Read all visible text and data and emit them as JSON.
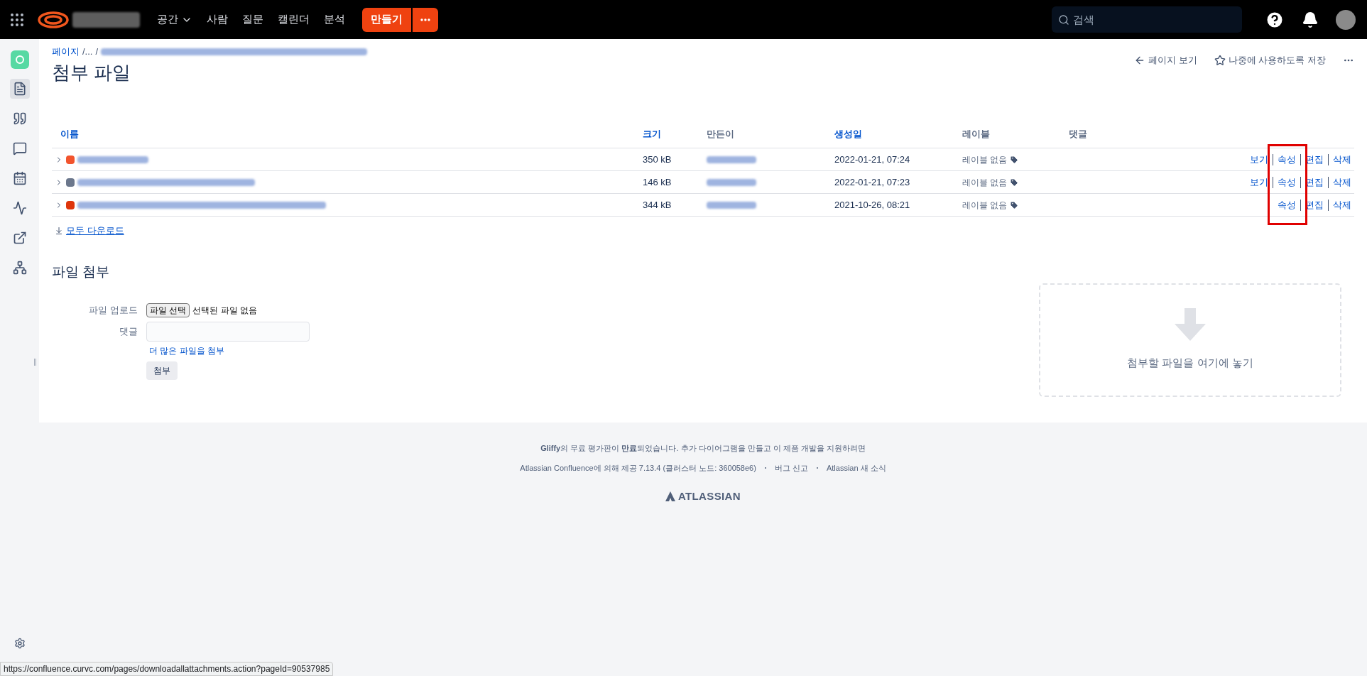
{
  "top_nav": {
    "menu": [
      {
        "label": "공간",
        "dropdown": true
      },
      {
        "label": "사람",
        "dropdown": false
      },
      {
        "label": "질문",
        "dropdown": false
      },
      {
        "label": "캘린더",
        "dropdown": false
      },
      {
        "label": "분석",
        "dropdown": false
      }
    ],
    "create_button": "만들기",
    "search": {
      "placeholder": "검색"
    }
  },
  "sidebar": {
    "items": [
      {
        "kind": "page",
        "selected": true
      },
      {
        "kind": "quote",
        "selected": false
      },
      {
        "kind": "question",
        "selected": false
      },
      {
        "kind": "calendar",
        "selected": false
      },
      {
        "kind": "activity",
        "selected": false
      },
      {
        "kind": "external",
        "selected": false
      },
      {
        "kind": "tree",
        "selected": false
      }
    ]
  },
  "breadcrumb": [
    {
      "label": "페이지",
      "kind": "link"
    },
    {
      "label": "/...",
      "kind": "text"
    },
    {
      "label": "/",
      "kind": "text"
    }
  ],
  "page_title": "첨부 파일",
  "page_actions": [
    {
      "label": "페이지 보기",
      "kind": "back"
    },
    {
      "label": "나중에 사용하도록 저장",
      "kind": "save"
    }
  ],
  "table": {
    "columns": [
      {
        "label": "이름",
        "sortable": true
      },
      {
        "label": "크기",
        "sortable": true
      },
      {
        "label": "만든이",
        "sortable": false
      },
      {
        "label": "생성일",
        "sortable": true
      },
      {
        "label": "레이블",
        "sortable": false
      },
      {
        "label": "댓글",
        "sortable": false
      }
    ],
    "rows": [
      {
        "color": "#f2542d",
        "size": "350 kB",
        "created": "2022-01-21, 07:24",
        "labels": "레이블 없음",
        "actions": [
          "보기",
          "속성",
          "편집",
          "삭제"
        ]
      },
      {
        "color": "#6b778c",
        "size": "146 kB",
        "created": "2022-01-21, 07:23",
        "labels": "레이블 없음",
        "actions": [
          "보기",
          "속성",
          "편집",
          "삭제"
        ]
      },
      {
        "color": "#de350b",
        "size": "344 kB",
        "created": "2021-10-26, 08:21",
        "labels": "레이블 없음",
        "actions": [
          "속성",
          "편집",
          "삭제"
        ]
      }
    ],
    "download_all": "모두 다운로드"
  },
  "attach": {
    "heading": "파일 첨부",
    "upload_label": "파일 업로드",
    "choose_button": "파일 선택",
    "no_file": "선택된 파일 없음",
    "comment_label": "댓글",
    "more_link": "더 많은 파일을 첨부",
    "submit_button": "첨부",
    "drop_zone": "첨부할 파일을 여기에 놓기"
  },
  "footer": {
    "notice": "**Gliffy**의 무료 평가판이 **만료**되었습니다. 추가 다이어그램을 만들고 이 제품 개발을 지원하려면",
    "links": [
      "Atlassian Confluence에 의해 제공 7.13.4 (클러스터 노드: 360058e6)",
      "버그 신고",
      "Atlassian 새 소식"
    ],
    "brand": "ATLASSIAN"
  },
  "status_url": "https://confluence.curvc.com/pages/downloadallattachments.action?pageId=90537985"
}
